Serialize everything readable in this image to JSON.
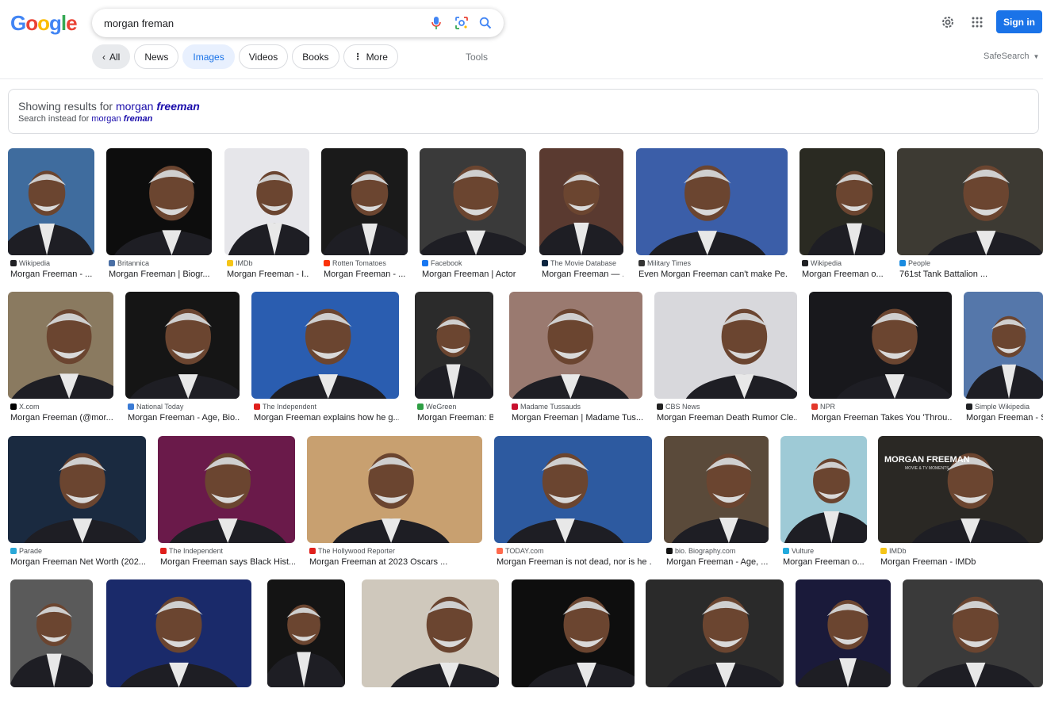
{
  "search": {
    "query": "morgan freman"
  },
  "chips": [
    {
      "label": "All",
      "state": "all"
    },
    {
      "label": "News"
    },
    {
      "label": "Images",
      "state": "images"
    },
    {
      "label": "Videos"
    },
    {
      "label": "Books"
    },
    {
      "label": "More"
    }
  ],
  "tools_label": "Tools",
  "safesearch_label": "SafeSearch",
  "signin_label": "Sign in",
  "spelling": {
    "showing_prefix": "Showing results for",
    "corrected_plain": "morgan",
    "corrected_bold": "freeman",
    "instead_prefix": "Search instead for",
    "original_plain": "morgan",
    "original_bold": "freman"
  },
  "colors": {
    "accent": "#1a73e8",
    "link": "#1a0dab"
  },
  "rows": [
    [
      {
        "source": "Wikipedia",
        "caption": "Morgan Freeman - ...",
        "fav": "#202124",
        "bg": "#3f6c9e"
      },
      {
        "source": "Britannica",
        "caption": "Morgan Freeman | Biogr...",
        "fav": "#4a6fa5",
        "bg": "#0d0d0d"
      },
      {
        "source": "IMDb",
        "caption": "Morgan Freeman - I...",
        "fav": "#f5c518",
        "bg": "#e6e6ea"
      },
      {
        "source": "Rotten Tomatoes",
        "caption": "Morgan Freeman - ...",
        "fav": "#fa320a",
        "bg": "#1a1a1a"
      },
      {
        "source": "Facebook",
        "caption": "Morgan Freeman | Actor",
        "fav": "#1877f2",
        "bg": "#3a3a3a"
      },
      {
        "source": "The Movie Database",
        "caption": "Morgan Freeman — ...",
        "fav": "#0d253f",
        "bg": "#5a3a30"
      },
      {
        "source": "Military Times",
        "caption": "Even Morgan Freeman can't make Pe...",
        "fav": "#333333",
        "bg": "#3b5ea8"
      },
      {
        "source": "Wikipedia",
        "caption": "Morgan Freeman o...",
        "fav": "#202124",
        "bg": "#2a2a22"
      },
      {
        "source": "People",
        "caption": "761st Tank Battalion ...",
        "fav": "#1a8be0",
        "bg": "#3d3a33"
      }
    ],
    [
      {
        "source": "X.com",
        "caption": "Morgan Freeman (@mor...",
        "fav": "#000000",
        "bg": "#8a7a60"
      },
      {
        "source": "National Today",
        "caption": "Morgan Freeman - Age, Bio...",
        "fav": "#3a7bd5",
        "bg": "#151515"
      },
      {
        "source": "The Independent",
        "caption": "Morgan Freeman explains how he g...",
        "fav": "#e0201c",
        "bg": "#2a5db0"
      },
      {
        "source": "WeGreen",
        "caption": "Morgan Freeman: B...",
        "fav": "#2e9e44",
        "bg": "#2b2b2b"
      },
      {
        "source": "Madame Tussauds",
        "caption": "Morgan Freeman | Madame Tus...",
        "fav": "#c8102e",
        "bg": "#9a7a70"
      },
      {
        "source": "CBS News",
        "caption": "Morgan Freeman Death Rumor Cle...",
        "fav": "#222222",
        "bg": "#d8d8dc"
      },
      {
        "source": "NPR",
        "caption": "Morgan Freeman Takes You 'Throu...",
        "fav": "#e3372a",
        "bg": "#18181c"
      },
      {
        "source": "Simple Wikipedia",
        "caption": "Morgan Freeman - S",
        "fav": "#202124",
        "bg": "#5577aa"
      }
    ],
    [
      {
        "source": "Parade",
        "caption": "Morgan Freeman Net Worth (202...",
        "fav": "#2aa8d8",
        "bg": "#1a2a40"
      },
      {
        "source": "The Independent",
        "caption": "Morgan Freeman says Black Hist...",
        "fav": "#e0201c",
        "bg": "#6a1a4a"
      },
      {
        "source": "The Hollywood Reporter",
        "caption": "Morgan Freeman at 2023 Oscars ...",
        "fav": "#e0201c",
        "bg": "#c8a070"
      },
      {
        "source": "TODAY.com",
        "caption": "Morgan Freeman is not dead, nor is he ...",
        "fav": "#ff6a4d",
        "bg": "#2d5aa0"
      },
      {
        "source": "bio. Biography.com",
        "caption": "Morgan Freeman - Age, ...",
        "fav": "#111111",
        "bg": "#5a4a3a"
      },
      {
        "source": "Vulture",
        "caption": "Morgan Freeman o...",
        "fav": "#22aadd",
        "bg": "#9ecad6"
      },
      {
        "source": "IMDb",
        "caption": "Morgan Freeman - IMDb",
        "fav": "#f5c518",
        "bg": "#2a2824",
        "overlay_title": "MORGAN FREEMAN",
        "overlay_sub": "MOVIE & TV MOMENTS"
      }
    ],
    [
      {
        "bg": "#5a5a5a"
      },
      {
        "bg": "#1a2a6a"
      },
      {
        "bg": "#141414"
      },
      {
        "bg": "#cfc8bc"
      },
      {
        "bg": "#0e0e0e"
      },
      {
        "bg": "#2a2a2a"
      },
      {
        "bg": "#1a1a3a"
      },
      {
        "bg": "#3a3a3a"
      }
    ]
  ]
}
